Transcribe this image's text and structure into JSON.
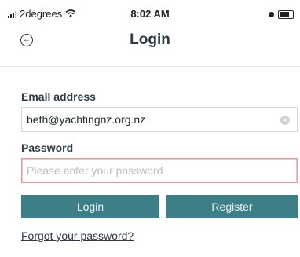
{
  "status": {
    "carrier": "2degrees",
    "time": "8:02 AM"
  },
  "nav": {
    "title": "Login",
    "back_icon": "circle-arrow-left-icon"
  },
  "form": {
    "email_label": "Email address",
    "email_value": "beth@yachtingnz.org.nz",
    "password_label": "Password",
    "password_placeholder": "Please enter your password",
    "login_label": "Login",
    "register_label": "Register",
    "forgot_label": "Forgot your password?"
  },
  "colors": {
    "button_bg": "#3c7f86",
    "error_border": "#e69a9a"
  }
}
